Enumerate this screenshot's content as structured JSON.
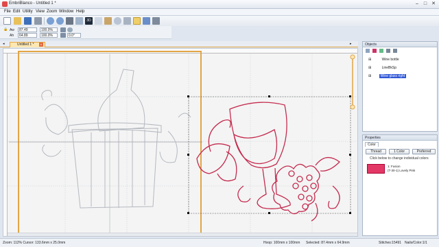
{
  "app": {
    "title": "EmbriBlanco - Untitled 1 *"
  },
  "menu": [
    "File",
    "Edit",
    "Utility",
    "View",
    "Zoom",
    "Window",
    "Help"
  ],
  "toolbar2": {
    "field_w": "87.49",
    "field_w_pct": "100.0%",
    "field_h": "64.89",
    "field_h_pct": "100.0%",
    "angle": "0.0°",
    "label_aw": "Aw",
    "label_ah": "Ah"
  },
  "document": {
    "tab": "Untitled 1 *"
  },
  "objects": {
    "header": "Objects",
    "items": [
      {
        "label": "Wine bottle",
        "selected": false
      },
      {
        "label": "LineBkSp",
        "selected": false
      },
      {
        "label": "Wine glass right",
        "selected": true
      }
    ]
  },
  "properties": {
    "header": "Properties",
    "tab": "Color",
    "buttons": {
      "thread": "Thread",
      "one_color": "1 Color",
      "preferred": "Preferred"
    },
    "hint": "Click below to change individual colors",
    "swatch": {
      "color": "#e33866",
      "line1": "1: Fusion",
      "line2": "(T-30-1) Lovely Pink"
    }
  },
  "status": {
    "zoom": "Zoom: 112%  Cursor: 133.6mm x 25.0mm",
    "hoop": "Hoop: 100mm x 100mm",
    "selected": "Selected: 87.4mm x 64.9mm",
    "stitches": "Stitches:15491",
    "nails": "Nails/Color:1/1"
  },
  "colors": {
    "accent": "#e2a544",
    "selection": "#2f57d6",
    "design_red": "#c42b4e",
    "design_grey": "#b4b8bf"
  }
}
